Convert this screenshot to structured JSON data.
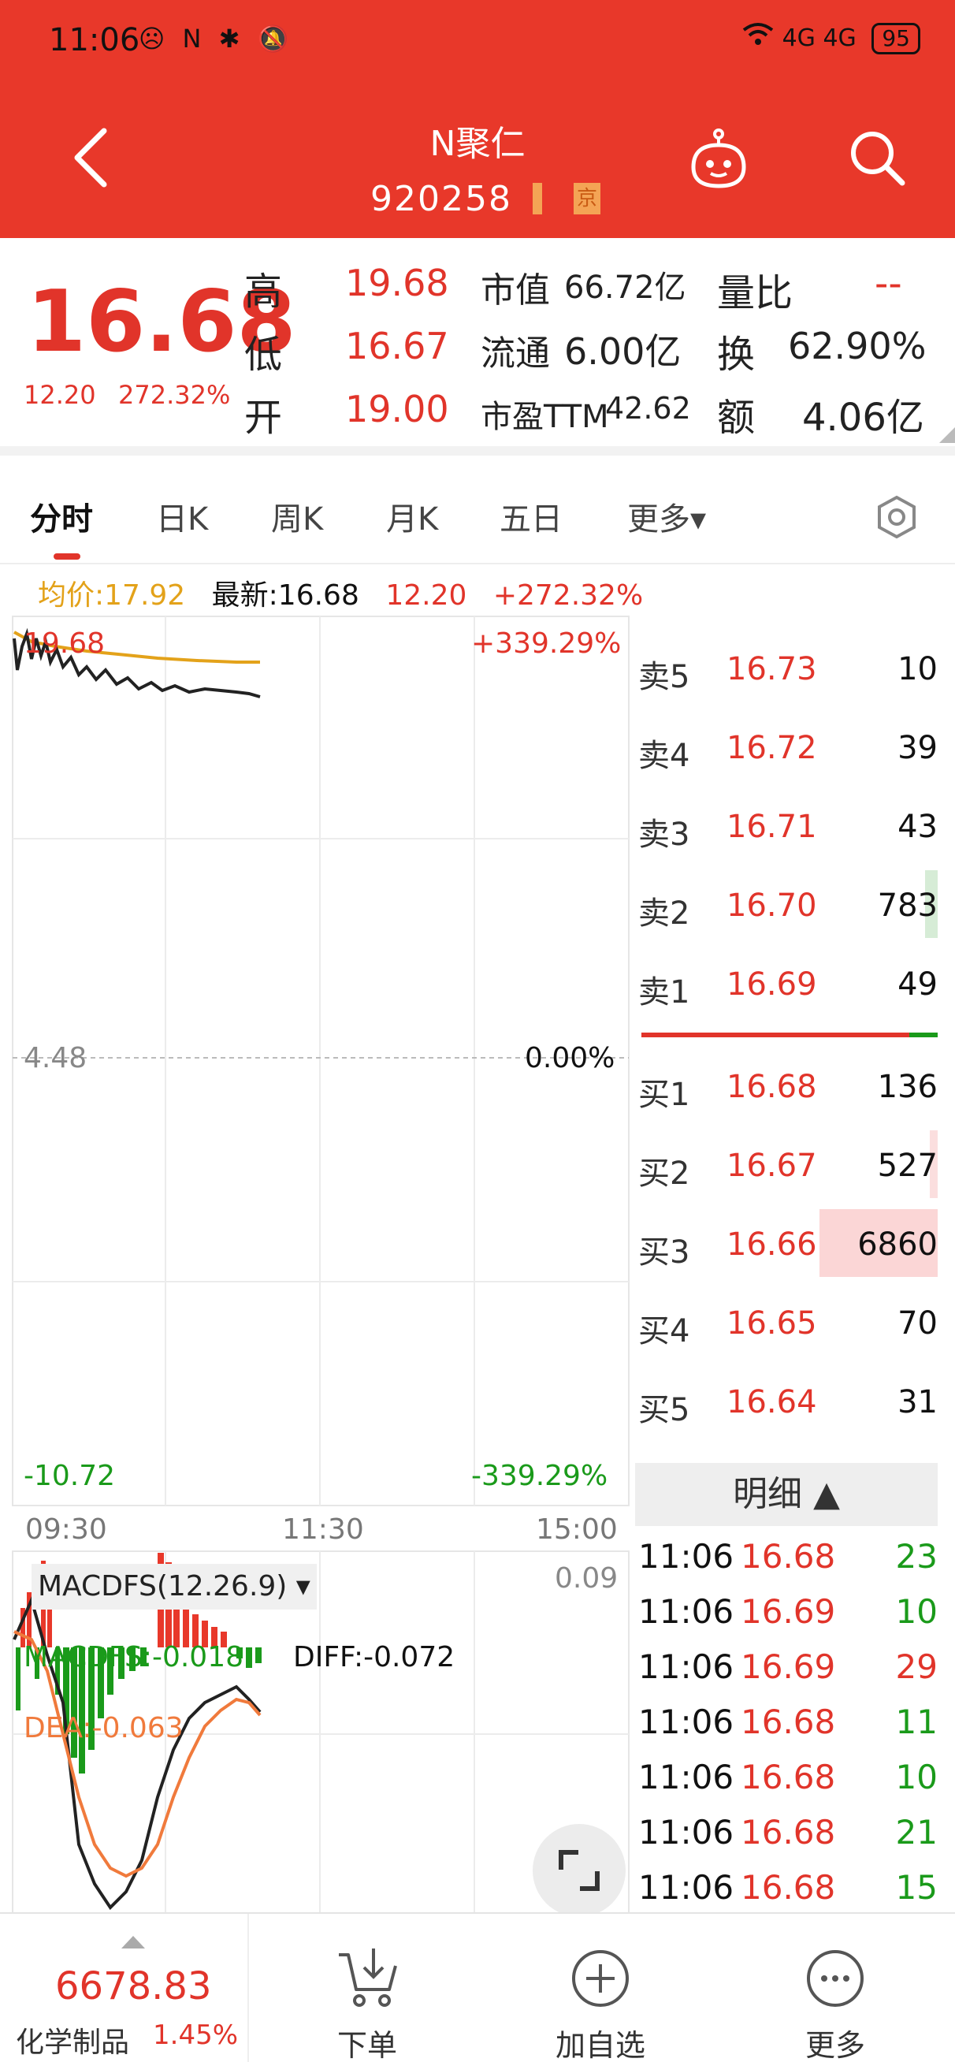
{
  "status_bar": {
    "time": "11:06",
    "icons": "☹ N ✱ 🔕",
    "network": "4G 4G",
    "battery": "95"
  },
  "header": {
    "stock_name": "N聚仁",
    "stock_code": "920258",
    "tag": "京"
  },
  "quote": {
    "last_price": "16.68",
    "change_abs": "12.20",
    "change_pct": "272.32%",
    "high_label": "高",
    "high": "19.68",
    "low_label": "低",
    "low": "16.67",
    "open_label": "开",
    "open": "19.00",
    "mcap_label": "市值",
    "mcap": "66.72亿",
    "float_label": "流通",
    "float": "6.00亿",
    "pe_label": "市盈TTM",
    "pe": "42.62",
    "volratio_label": "量比",
    "volratio": "--",
    "turnover_label": "换",
    "turnover": "62.90%",
    "amount_label": "额",
    "amount": "4.06亿"
  },
  "tabs": [
    "分时",
    "日K",
    "周K",
    "月K",
    "五日",
    "更多▾"
  ],
  "info_line": {
    "avg": "均价:17.92",
    "latest": "最新:16.68",
    "chg": "12.20",
    "pct": "+272.32%"
  },
  "chart_axis": {
    "top_left": "19.68",
    "top_right": "+339.29%",
    "mid_left": "4.48",
    "mid_right": "0.00%",
    "bottom_left": "-10.72",
    "bottom_right": "-339.29%",
    "time_start": "09:30",
    "time_mid": "11:30",
    "time_end": "15:00"
  },
  "macd": {
    "selector": "MACDFS(12.26.9) ▾",
    "top_value": "0.09",
    "macdfs": "MACDFS:-0.018",
    "diff": "DIFF:-0.072",
    "dea": "DEA:-0.063"
  },
  "order_book": {
    "asks": [
      {
        "label": "卖5",
        "price": "16.73",
        "vol": "10"
      },
      {
        "label": "卖4",
        "price": "16.72",
        "vol": "39"
      },
      {
        "label": "卖3",
        "price": "16.71",
        "vol": "43"
      },
      {
        "label": "卖2",
        "price": "16.70",
        "vol": "783"
      },
      {
        "label": "卖1",
        "price": "16.69",
        "vol": "49"
      }
    ],
    "bids": [
      {
        "label": "买1",
        "price": "16.68",
        "vol": "136"
      },
      {
        "label": "买2",
        "price": "16.67",
        "vol": "527"
      },
      {
        "label": "买3",
        "price": "16.66",
        "vol": "6860"
      },
      {
        "label": "买4",
        "price": "16.65",
        "vol": "70"
      },
      {
        "label": "买5",
        "price": "16.64",
        "vol": "31"
      }
    ]
  },
  "detail": {
    "title": "明细 ▲",
    "rows": [
      {
        "time": "11:06",
        "price": "16.68",
        "vol": "23"
      },
      {
        "time": "11:06",
        "price": "16.69",
        "vol": "10"
      },
      {
        "time": "11:06",
        "price": "16.69",
        "vol": "29"
      },
      {
        "time": "11:06",
        "price": "16.68",
        "vol": "11"
      },
      {
        "time": "11:06",
        "price": "16.68",
        "vol": "10"
      },
      {
        "time": "11:06",
        "price": "16.68",
        "vol": "21"
      },
      {
        "time": "11:06",
        "price": "16.68",
        "vol": "15"
      }
    ]
  },
  "bottom_nav": {
    "index_value": "6678.83",
    "index_name": "化学制品",
    "index_pct": "1.45%",
    "order_label": "下单",
    "watch_label": "加自选",
    "more_label": "更多"
  },
  "colors": {
    "header_red": "#e8382a",
    "up_red": "#e1342a",
    "down_green": "#1a9a1a",
    "avg_line": "#e3a21a"
  }
}
